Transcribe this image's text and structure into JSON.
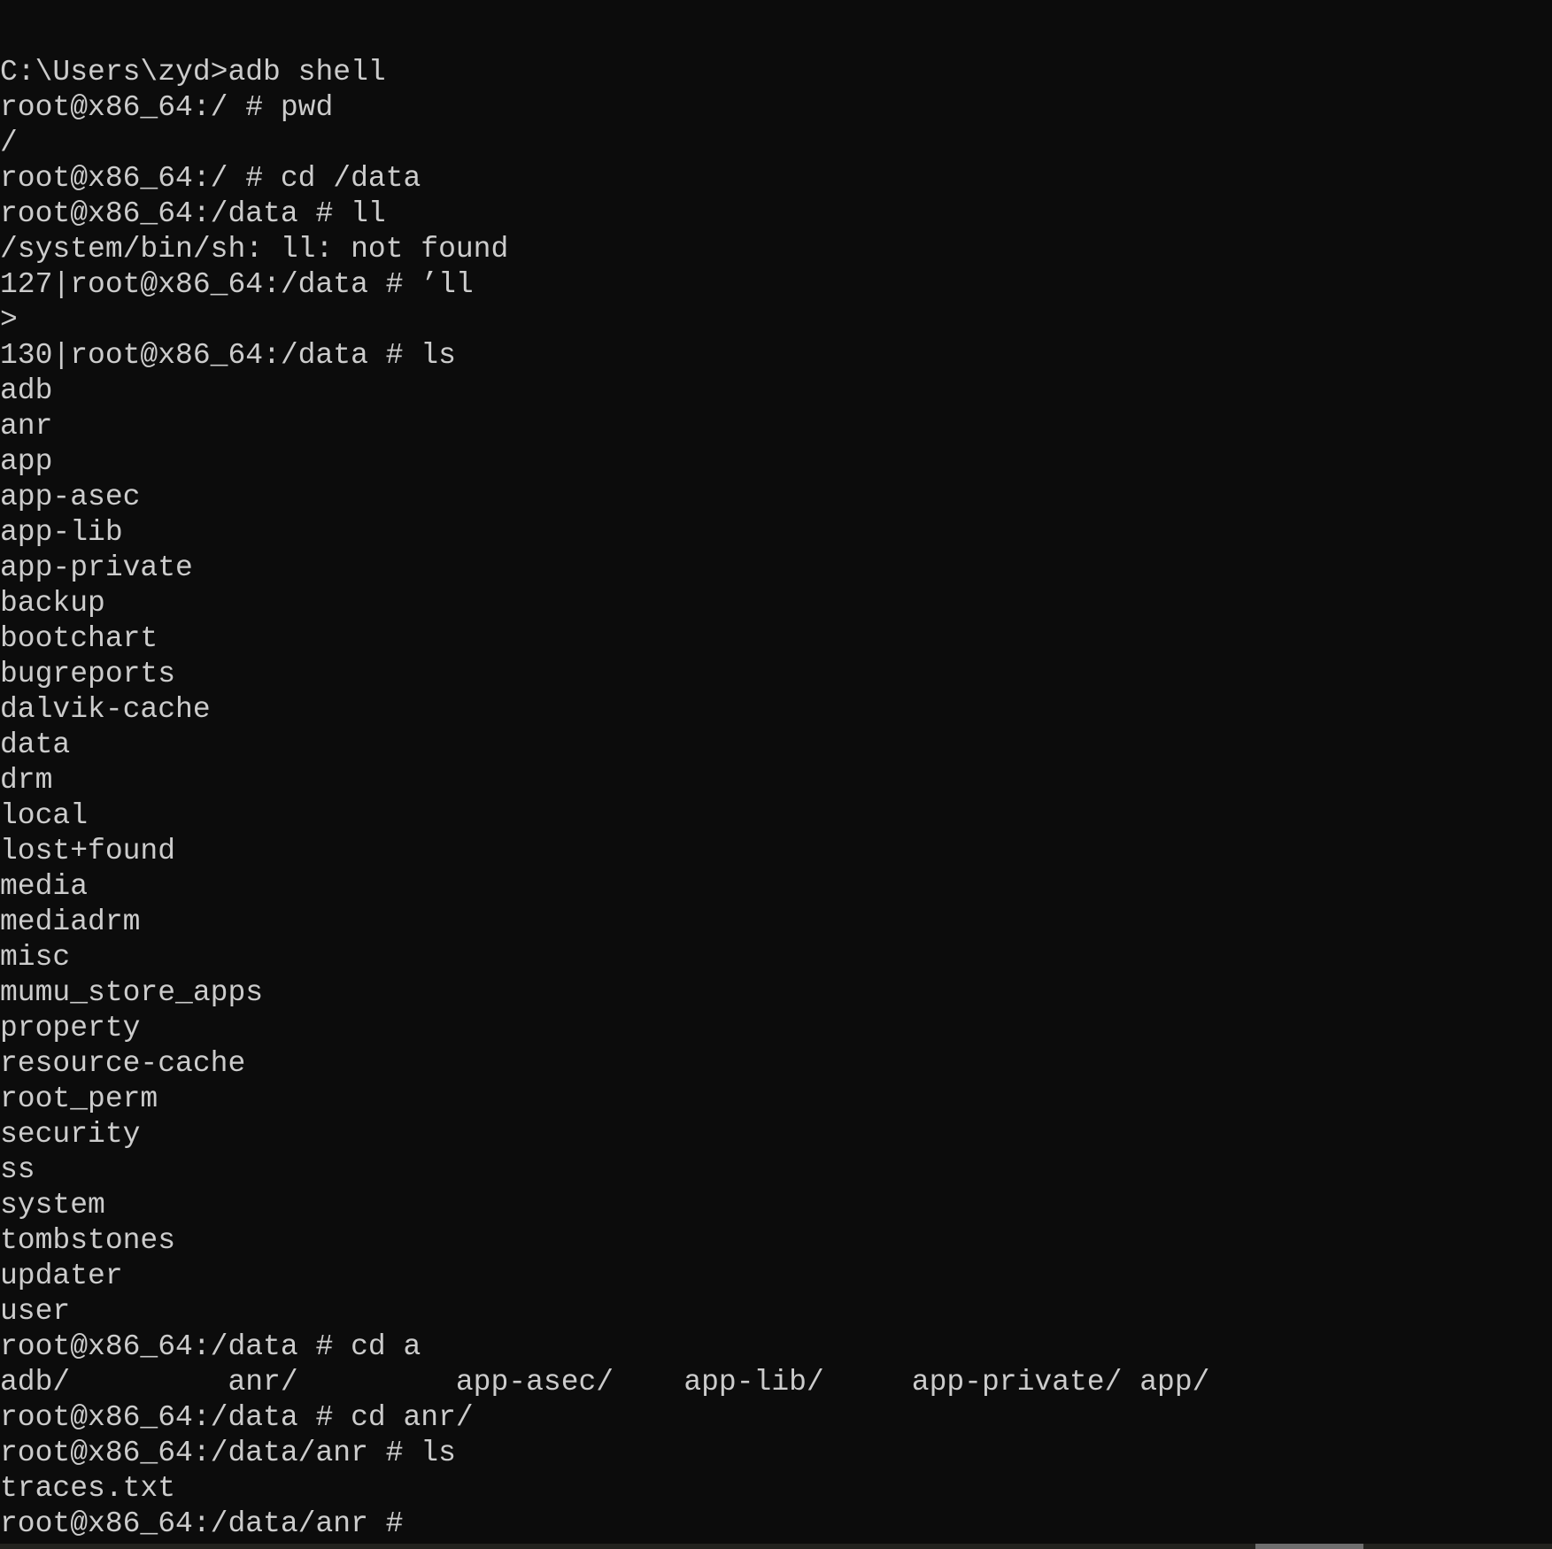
{
  "terminal": {
    "lines": [
      "C:\\Users\\zyd>adb shell",
      "root@x86_64:/ # pwd",
      "/",
      "root@x86_64:/ # cd /data",
      "root@x86_64:/data # ll",
      "/system/bin/sh: ll: not found",
      "127|root@x86_64:/data # ’ll",
      ">",
      "130|root@x86_64:/data # ls",
      "adb",
      "anr",
      "app",
      "app-asec",
      "app-lib",
      "app-private",
      "backup",
      "bootchart",
      "bugreports",
      "dalvik-cache",
      "data",
      "drm",
      "local",
      "lost+found",
      "media",
      "mediadrm",
      "misc",
      "mumu_store_apps",
      "property",
      "resource-cache",
      "root_perm",
      "security",
      "ss",
      "system",
      "tombstones",
      "updater",
      "user",
      "root@x86_64:/data # cd a",
      "adb/         anr/         app-asec/    app-lib/     app-private/ app/",
      "root@x86_64:/data # cd anr/",
      "root@x86_64:/data/anr # ls",
      "traces.txt",
      "root@x86_64:/data/anr #"
    ]
  },
  "colors": {
    "background": "#0c0c0c",
    "text": "#cccccc"
  },
  "scrollbar": {
    "horizontal_position_percent": 81
  }
}
